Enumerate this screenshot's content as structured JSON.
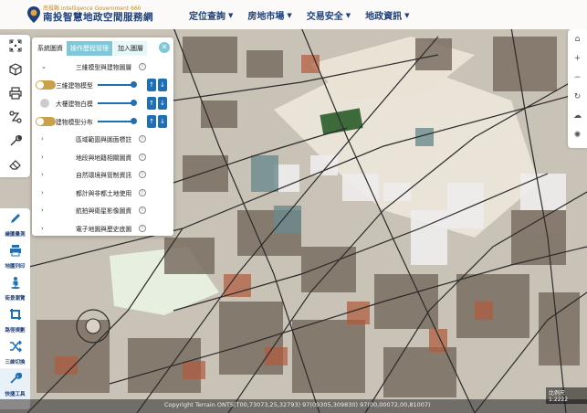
{
  "header": {
    "logo_small": "南投縣 Intelligence Government 660",
    "logo_big": "南投智慧地政空間服務網",
    "nav": [
      {
        "label": "定位查詢"
      },
      {
        "label": "房地市場"
      },
      {
        "label": "交易安全"
      },
      {
        "label": "地政資訊"
      }
    ]
  },
  "panel": {
    "tabs": [
      "系統圖資",
      "操作歷程管理",
      "加入圖層"
    ],
    "close": "✕",
    "group": "三維模型與建物圖層",
    "sublayers": [
      {
        "label": "三維建物模型",
        "on": true
      },
      {
        "label": "大樓建物白模",
        "on": false
      },
      {
        "label": "建物模型分布",
        "on": true
      }
    ],
    "categories": [
      "區域範圍與圖面標註",
      "地段與地籍相關圖資",
      "自然環境與管制資訊",
      "都計與非都土地使用",
      "航拍與衛星影像圖資",
      "電子地圖與歷史底圖"
    ]
  },
  "leftbar": {
    "tools": [
      "points-icon",
      "cube-icon",
      "print-icon",
      "route-icon",
      "wrench-icon",
      "eraser-icon"
    ],
    "quick": [
      {
        "label": "繪圖量測"
      },
      {
        "label": "地圖列印"
      },
      {
        "label": "街景瀏覽"
      },
      {
        "label": "路徑規劃"
      },
      {
        "label": "三維切換"
      },
      {
        "label": "快捷工具"
      }
    ]
  },
  "rightbar": {
    "tools": [
      "home-icon",
      "plus-icon",
      "minus-icon",
      "rotate-icon",
      "layers-icon",
      "settings-icon"
    ]
  },
  "footer": {
    "copyright": "Copyright Terrain ONTS(T00,73073,25,32793) 97(09305,309830) 97(00,00072,00,81007)",
    "scale": "比例尺 1:2222"
  },
  "colors": {
    "brand": "#1e3f7a",
    "accent": "#7ec8d9",
    "toggle": "#c9a14a"
  }
}
